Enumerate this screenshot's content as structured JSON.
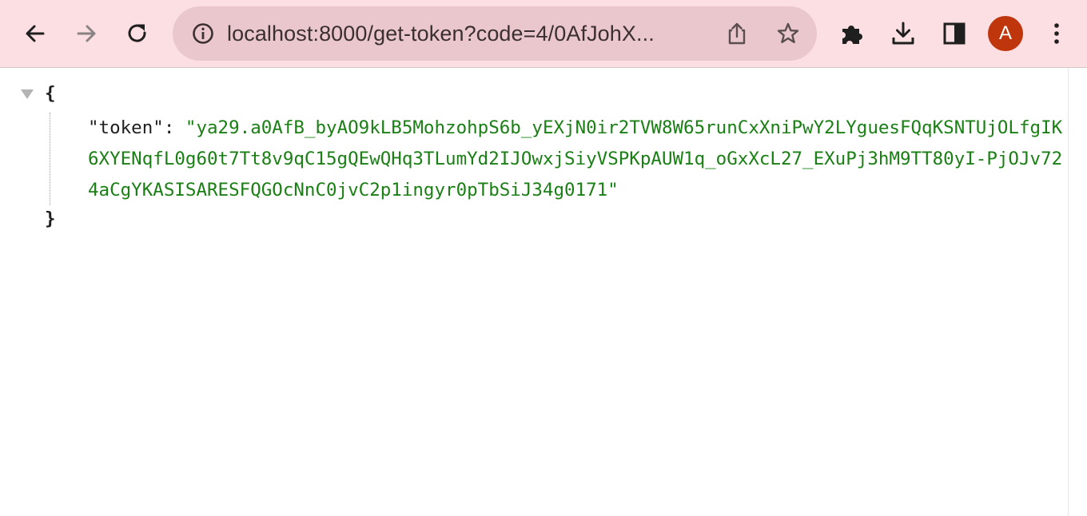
{
  "browser": {
    "url": "localhost:8000/get-token?code=4/0AfJohX...",
    "profile_initial": "A",
    "colors": {
      "toolbar": "#fcdfe3",
      "omnibox": "#e9c7cd",
      "avatar": "#bf360c"
    },
    "icons": {
      "back": "arrow-left-icon",
      "forward": "arrow-right-icon",
      "reload": "reload-icon",
      "site_info": "info-icon",
      "share": "share-icon",
      "bookmark": "star-icon",
      "extensions": "puzzle-icon",
      "downloads": "download-icon",
      "side_panel": "side-panel-icon",
      "menu": "kebab-menu-icon"
    }
  },
  "json_view": {
    "open_brace": "{",
    "close_brace": "}",
    "entries": [
      {
        "key": "\"token\"",
        "separator": ": ",
        "value": "\"ya29.a0AfB_byAO9kLB5MohzohpS6b_yEXjN0ir2TVW8W65runCxXniPwY2LYguesFQqKSNTUjOLfgIK6XYENqfL0g60t7Tt8v9qC15gQEwQHq3TLumYd2IJOwxjSiyVSPKpAUW1q_oGxXcL27_EXuPj3hM9TT80yI-PjOJv724aCgYKASISARESFQGOcNnC0jvC2p1ingyr0pTbSiJ34g0171\""
      }
    ],
    "colors": {
      "key": "#1f1f1f",
      "string_value": "#1a7f14"
    }
  }
}
